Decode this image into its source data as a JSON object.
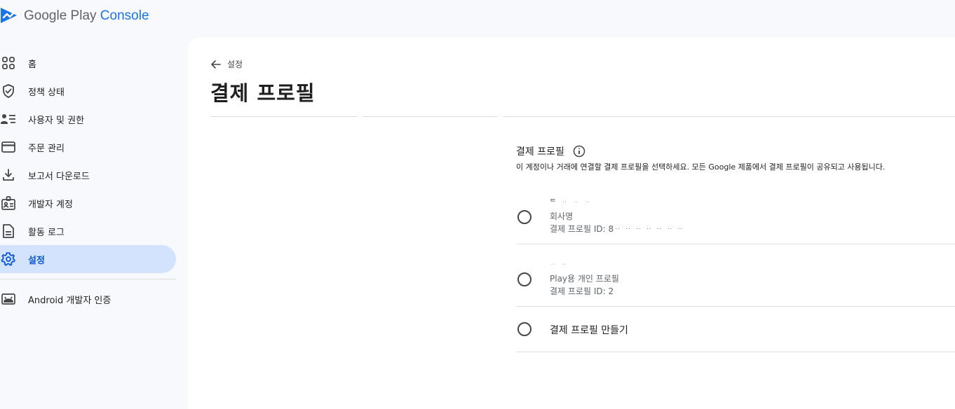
{
  "app": {
    "logo_prefix": "Google Play",
    "logo_accent": "Console"
  },
  "colors": {
    "accent": "#1a73e8",
    "active_nav_bg": "#d3e3fd",
    "active_nav_text": "#0b57d0"
  },
  "sidebar": {
    "items": [
      {
        "label": "홈",
        "icon": "home-grid-icon"
      },
      {
        "label": "정책 상태",
        "icon": "shield-check-icon"
      },
      {
        "label": "사용자 및 권한",
        "icon": "users-list-icon"
      },
      {
        "label": "주문 관리",
        "icon": "credit-card-icon"
      },
      {
        "label": "보고서 다운로드",
        "icon": "download-icon"
      },
      {
        "label": "개발자 계정",
        "icon": "id-badge-icon"
      },
      {
        "label": "활동 로그",
        "icon": "document-icon"
      },
      {
        "label": "설정",
        "icon": "gear-icon",
        "active": true
      }
    ],
    "android_item": {
      "label": "Android 개발자 인증",
      "icon": "android-icon"
    }
  },
  "page": {
    "back_label": "설정",
    "title": "결제 프로필"
  },
  "profile_section": {
    "title": "결제 프로필",
    "description": "이 계정이나 거래에 연결할 결제 프로필을 선택하세요. 모든 Google 제품에서 결제 프로필이 공유되고 사용됩니다.",
    "options": [
      {
        "name": "ᄐ ᆢ ᆢ ᆢ",
        "type": "회사명",
        "id": "결제 프로필 ID: 8ᆢ ᆢ ᆢ ᆢ ᆢ ᆢ ᆢ"
      },
      {
        "name": "ᆢ ᆢ",
        "type": "Play용 개인 프로필",
        "id": "결제 프로필 ID: 2"
      }
    ],
    "create_label": "결제 프로필 만들기"
  }
}
